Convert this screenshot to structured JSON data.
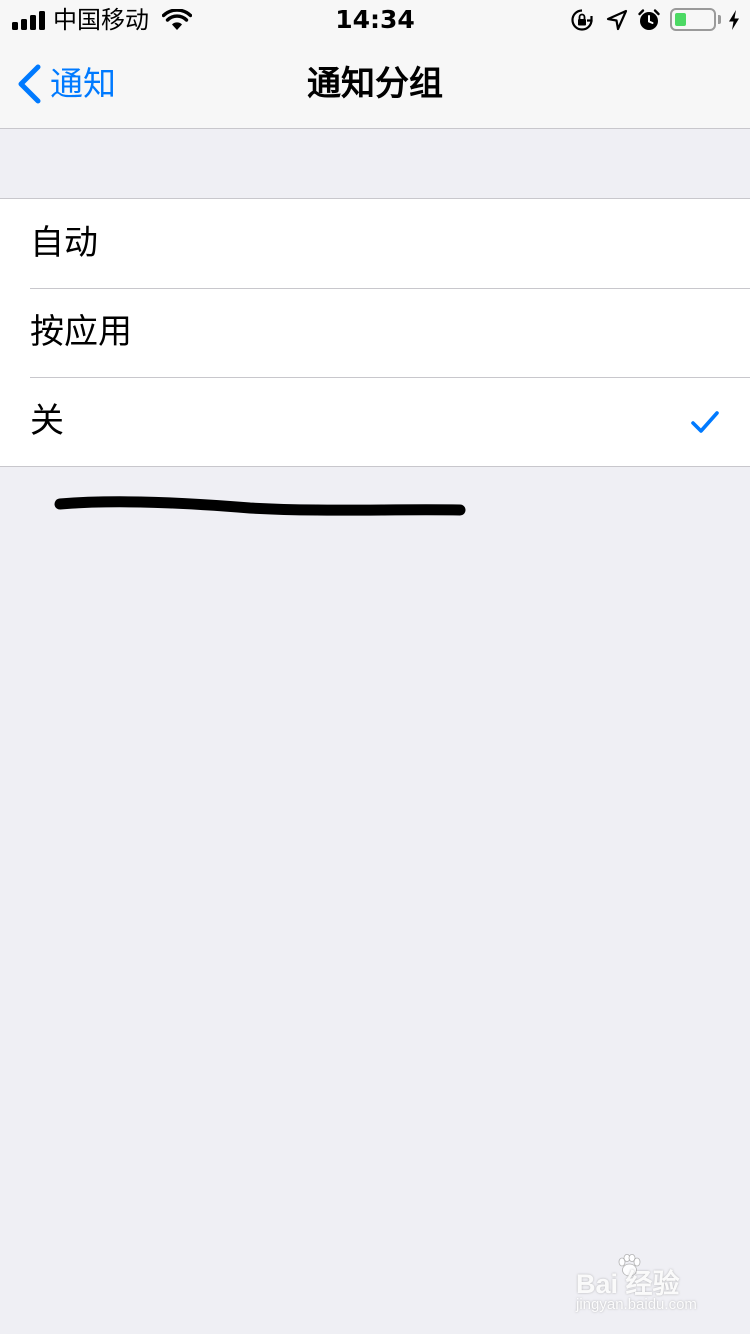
{
  "status_bar": {
    "carrier": "中国移动",
    "time": "14:34",
    "battery_level": 0.3,
    "icons": [
      "signal-icon",
      "wifi-icon",
      "rotation-lock-icon",
      "location-icon",
      "alarm-icon",
      "battery-icon",
      "charging-bolt-icon"
    ]
  },
  "nav": {
    "back_label": "通知",
    "title": "通知分组"
  },
  "options": [
    {
      "label": "自动",
      "selected": false
    },
    {
      "label": "按应用",
      "selected": false
    },
    {
      "label": "关",
      "selected": true
    }
  ],
  "colors": {
    "accent": "#007aff",
    "background": "#efeff4",
    "battery": "#4cd964"
  },
  "watermark": {
    "main": "Bai 经验",
    "sub": "jingyan.baidu.com"
  }
}
